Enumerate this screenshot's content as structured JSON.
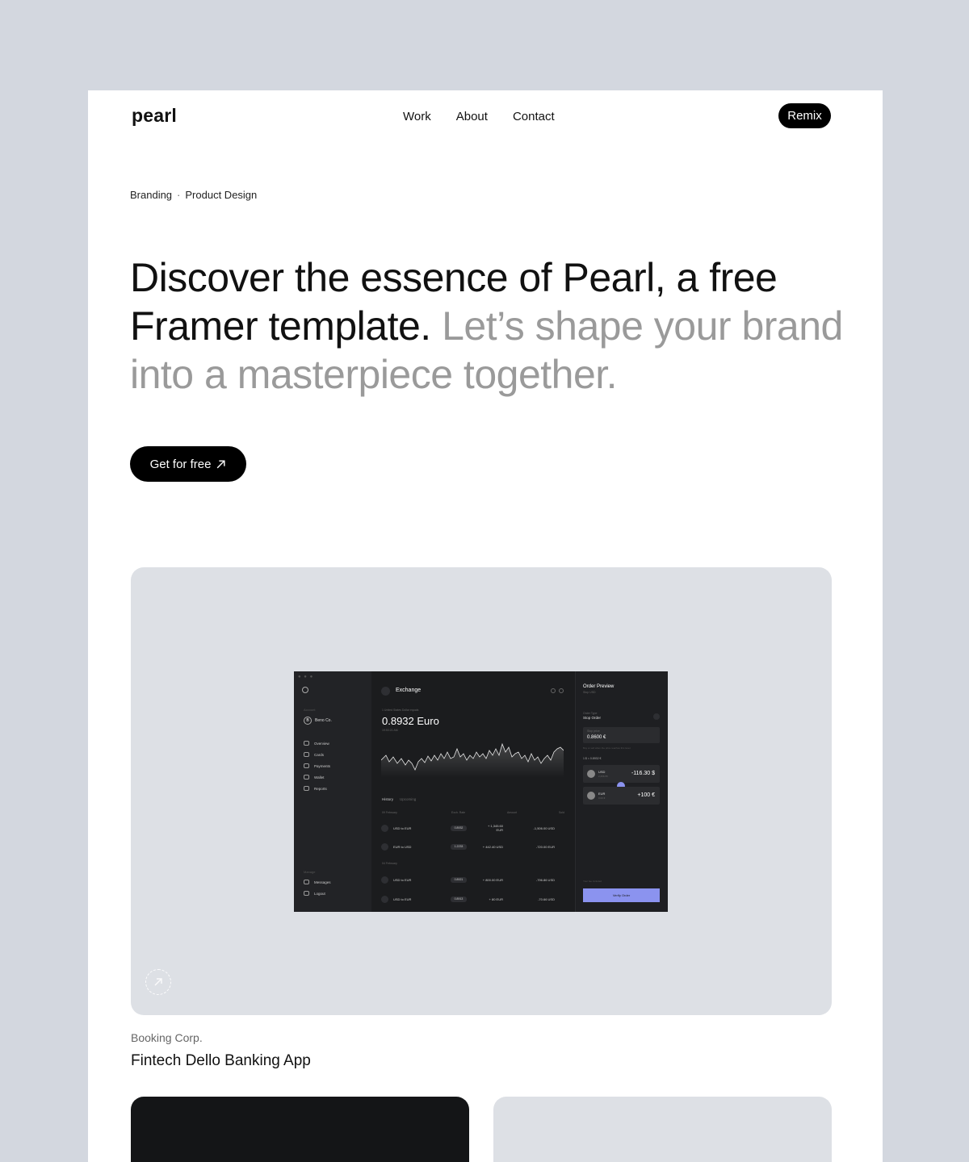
{
  "brand": {
    "logo": "pearl"
  },
  "nav": {
    "items": [
      "Work",
      "About",
      "Contact"
    ],
    "remix_label": "Remix"
  },
  "tags": [
    "Branding",
    "Product Design"
  ],
  "tag_separator": "·",
  "hero": {
    "dark_text": "Discover the essence of Pearl, a free Framer template.",
    "muted_text": "Let’s shape your brand into a masterpiece together."
  },
  "cta": {
    "label": "Get for free",
    "icon": "arrow-up-right-icon"
  },
  "colors": {
    "page_bg": "#d3d7df",
    "card_bg": "#dde0e5",
    "accent": "#8b93ef",
    "dark": "#000000"
  },
  "mock_app": {
    "account_label": "Account",
    "account_badge": "B",
    "account_name": "Beno Co.",
    "menu": [
      "Overview",
      "Cards",
      "Payments",
      "Wallet",
      "Reports"
    ],
    "bottom_label": "Manage",
    "bottom_menu": [
      "Messages",
      "Logout"
    ],
    "exchange_title": "Exchange",
    "rate_sub": "1 United States Dollar equals",
    "rate": "0.8932 Euro",
    "rate_time": "19:53:21 AM",
    "history_tabs": [
      "History",
      "Upcoming"
    ],
    "history_columns": [
      "Exch. Rate",
      "Amount",
      "Sold"
    ],
    "groups": [
      {
        "date": "09 February",
        "rows": [
          {
            "pair": "USD to EUR",
            "rate": "0.8932",
            "amount": "+ 1,345.60 EUR",
            "sold": "-1,506.00 USD"
          },
          {
            "pair": "EUR to USD",
            "rate": "1.2233",
            "amount": "+ 442.40 USD",
            "sold": "-720.00 EUR"
          }
        ]
      },
      {
        "date": "04 February",
        "rows": [
          {
            "pair": "USD to EUR",
            "rate": "0.8921",
            "amount": "+ 800.00 EUR",
            "sold": "-796.86 USD"
          },
          {
            "pair": "USD to EUR",
            "rate": "0.8913",
            "amount": "+ 80 EUR",
            "sold": "-70.66 USD"
          }
        ]
      }
    ],
    "order": {
      "title": "Order Preview",
      "subtitle": "Stop USD",
      "type_label": "Order Type",
      "type_value": "Stop Order",
      "price_label": "Stop price",
      "price_value": "0.8600 €",
      "note": "Buy or sell when the price reaches this level.",
      "conversion": "1 $ = 0.8932 €",
      "from": {
        "name": "USD",
        "balance": "2,256.55",
        "amount": "-116.30 $"
      },
      "to": {
        "name": "EUR",
        "balance": "0.00 €",
        "amount": "+100 €"
      },
      "fee": "Your fee included",
      "verify": "Verify Order"
    }
  },
  "case": {
    "client": "Booking Corp.",
    "title": "Fintech Dello Banking App"
  }
}
